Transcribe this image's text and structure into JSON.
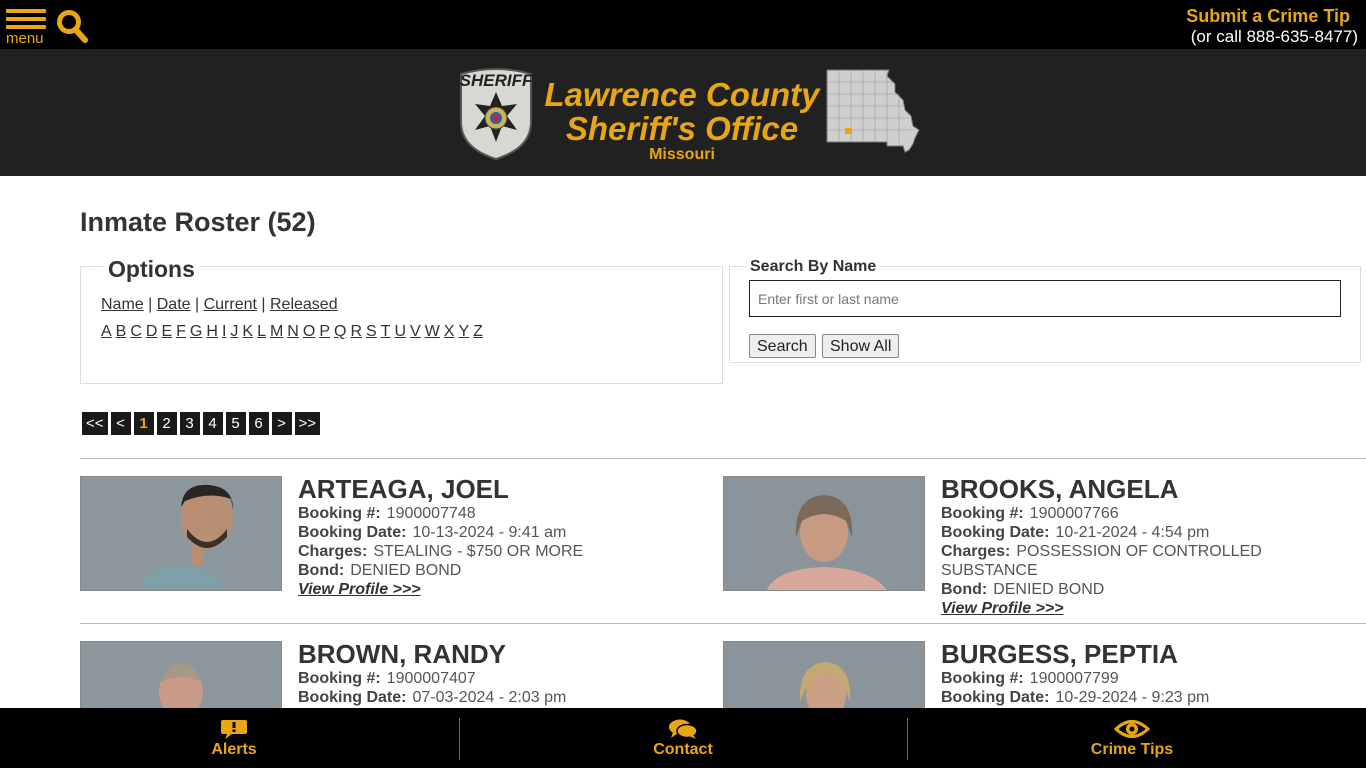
{
  "topbar": {
    "menu_label": "menu",
    "tip_title": "Submit a Crime Tip",
    "tip_phone": "(or call 888-635-8477)"
  },
  "header": {
    "title_line1": "Lawrence County",
    "title_line2": "Sheriff's Office",
    "state": "Missouri",
    "badge_text": "SHERIFF",
    "brand_color": "#e8a612"
  },
  "page_title": "Inmate Roster (52)",
  "options": {
    "legend": "Options",
    "links": [
      "Name",
      "Date",
      "Current",
      "Released"
    ],
    "letters": [
      "A",
      "B",
      "C",
      "D",
      "E",
      "F",
      "G",
      "H",
      "I",
      "J",
      "K",
      "L",
      "M",
      "N",
      "O",
      "P",
      "Q",
      "R",
      "S",
      "T",
      "U",
      "V",
      "W",
      "X",
      "Y",
      "Z"
    ]
  },
  "search": {
    "legend": "Search By Name",
    "placeholder": "Enter first or last name",
    "search_label": "Search",
    "show_all_label": "Show All"
  },
  "pager": {
    "first": "<<",
    "prev": "<",
    "pages": [
      "1",
      "2",
      "3",
      "4",
      "5",
      "6"
    ],
    "current": "1",
    "next": ">",
    "last": ">>"
  },
  "labels": {
    "booking_num": "Booking #:",
    "booking_date": "Booking Date:",
    "charges": "Charges:",
    "bond": "Bond:",
    "profile": "View Profile >>>"
  },
  "inmates": [
    {
      "name": "ARTEAGA, JOEL",
      "booking": "1900007748",
      "date": "10-13-2024 - 9:41 am",
      "charges": "STEALING - $750 OR MORE",
      "bond": "DENIED BOND"
    },
    {
      "name": "BROOKS, ANGELA",
      "booking": "1900007766",
      "date": "10-21-2024 - 4:54 pm",
      "charges": "POSSESSION OF CONTROLLED SUBSTANCE",
      "bond": "DENIED BOND"
    },
    {
      "name": "BROWN, RANDY",
      "booking": "1900007407",
      "date": "07-03-2024 - 2:03 pm"
    },
    {
      "name": "BURGESS, PEPTIA",
      "booking": "1900007799",
      "date": "10-29-2024 - 9:23 pm"
    }
  ],
  "bottombar": {
    "alerts": "Alerts",
    "contact": "Contact",
    "crime_tips": "Crime Tips"
  }
}
